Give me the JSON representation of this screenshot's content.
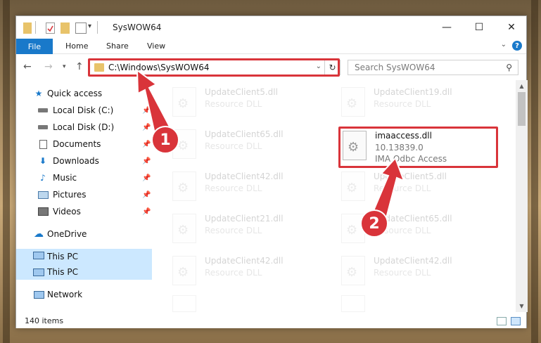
{
  "window": {
    "title": "SysWOW64"
  },
  "window_controls": {
    "minimize": "—",
    "maximize": "☐",
    "close": "✕"
  },
  "ribbon": {
    "file": "File",
    "home": "Home",
    "share": "Share",
    "view": "View",
    "help": "?"
  },
  "address": {
    "path": "C:\\Windows\\SysWOW64"
  },
  "search": {
    "placeholder": "Search SysWOW64"
  },
  "sidebar": {
    "items": [
      {
        "label": "Quick access"
      },
      {
        "label": "Local Disk (C:)"
      },
      {
        "label": "Local Disk (D:)"
      },
      {
        "label": "Documents"
      },
      {
        "label": "Downloads"
      },
      {
        "label": "Music"
      },
      {
        "label": "Pictures"
      },
      {
        "label": "Videos"
      },
      {
        "label": "OneDrive"
      },
      {
        "label": "This PC"
      },
      {
        "label": "Network"
      }
    ]
  },
  "files": {
    "highlighted": {
      "name": "imaaccess.dll",
      "version": "10.13839.0",
      "description": "IMA Odbc Access"
    },
    "background": [
      {
        "name": "UpdateClient5.dll",
        "type": "Resource DLL"
      },
      {
        "name": "UpdateClient19.dll",
        "type": "Resource DLL"
      },
      {
        "name": "UpdateClient65.dll",
        "type": "Resource DLL"
      },
      {
        "name": "UpdateClient42.dll",
        "type": "Resource DLL"
      },
      {
        "name": "UpdateClient5.dll",
        "type": "Resource DLL"
      },
      {
        "name": "UpdateClient21.dll",
        "type": "Resource DLL"
      },
      {
        "name": "UpdateClient65.dll",
        "type": "Resource DLL"
      },
      {
        "name": "UpdateClient42.dll",
        "type": "Resource DLL"
      },
      {
        "name": "UpdateClient42.dll",
        "type": "Resource DLL"
      }
    ]
  },
  "status": {
    "item_count": "140 items"
  },
  "annotations": {
    "step1": "1",
    "step2": "2"
  },
  "colors": {
    "accent": "#1979ca",
    "highlight": "#d9343a",
    "selected": "#cce8ff"
  }
}
